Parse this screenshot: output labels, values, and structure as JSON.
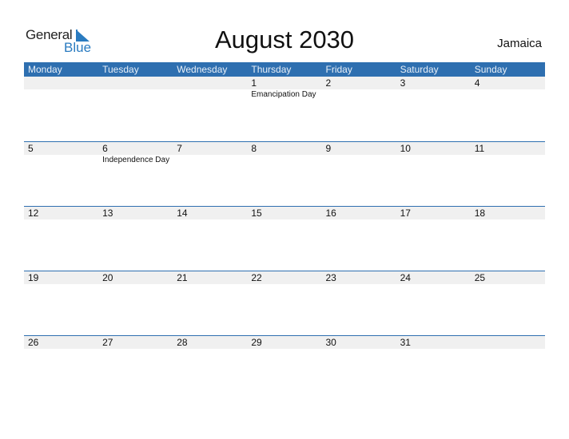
{
  "logo": {
    "word1": "General",
    "word2": "Blue"
  },
  "title": "August 2030",
  "country": "Jamaica",
  "colors": {
    "accent": "#2e6fb0",
    "band": "#f0f0f0",
    "logo_blue": "#2a7bc0"
  },
  "weekdays": [
    "Monday",
    "Tuesday",
    "Wednesday",
    "Thursday",
    "Friday",
    "Saturday",
    "Sunday"
  ],
  "weeks": [
    [
      {
        "day": "",
        "event": ""
      },
      {
        "day": "",
        "event": ""
      },
      {
        "day": "",
        "event": ""
      },
      {
        "day": "1",
        "event": "Emancipation Day"
      },
      {
        "day": "2",
        "event": ""
      },
      {
        "day": "3",
        "event": ""
      },
      {
        "day": "4",
        "event": ""
      }
    ],
    [
      {
        "day": "5",
        "event": ""
      },
      {
        "day": "6",
        "event": "Independence Day"
      },
      {
        "day": "7",
        "event": ""
      },
      {
        "day": "8",
        "event": ""
      },
      {
        "day": "9",
        "event": ""
      },
      {
        "day": "10",
        "event": ""
      },
      {
        "day": "11",
        "event": ""
      }
    ],
    [
      {
        "day": "12",
        "event": ""
      },
      {
        "day": "13",
        "event": ""
      },
      {
        "day": "14",
        "event": ""
      },
      {
        "day": "15",
        "event": ""
      },
      {
        "day": "16",
        "event": ""
      },
      {
        "day": "17",
        "event": ""
      },
      {
        "day": "18",
        "event": ""
      }
    ],
    [
      {
        "day": "19",
        "event": ""
      },
      {
        "day": "20",
        "event": ""
      },
      {
        "day": "21",
        "event": ""
      },
      {
        "day": "22",
        "event": ""
      },
      {
        "day": "23",
        "event": ""
      },
      {
        "day": "24",
        "event": ""
      },
      {
        "day": "25",
        "event": ""
      }
    ],
    [
      {
        "day": "26",
        "event": ""
      },
      {
        "day": "27",
        "event": ""
      },
      {
        "day": "28",
        "event": ""
      },
      {
        "day": "29",
        "event": ""
      },
      {
        "day": "30",
        "event": ""
      },
      {
        "day": "31",
        "event": ""
      },
      {
        "day": "",
        "event": ""
      }
    ]
  ]
}
